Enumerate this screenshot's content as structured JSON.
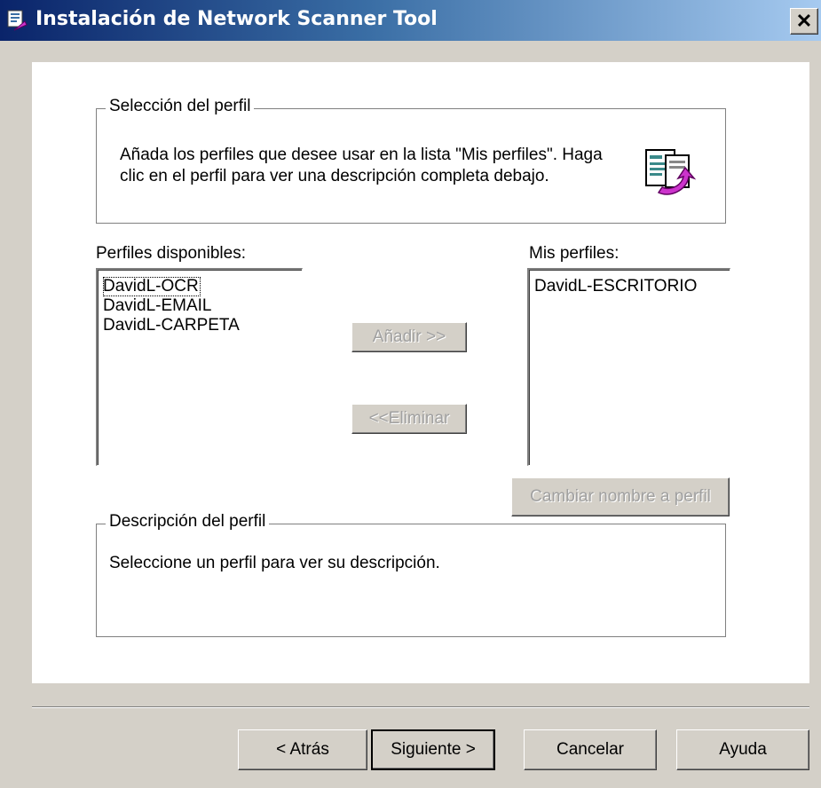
{
  "window": {
    "title": "Instalación de Network Scanner Tool",
    "close_glyph": "✕"
  },
  "selection_group": {
    "legend": "Selección del perfil",
    "instructions": "Añada los perfiles que desee usar en la lista \"Mis perfiles\". Haga clic en el perfil para ver una descripción completa debajo.",
    "icon": "profile-document-arrow-icon"
  },
  "available": {
    "label": "Perfiles disponibles:",
    "items": [
      "DavidL-OCR",
      "DavidL-EMAIL",
      "DavidL-CARPETA"
    ]
  },
  "mine": {
    "label": "Mis perfiles:",
    "items": [
      "DavidL-ESCRITORIO"
    ]
  },
  "buttons": {
    "add": "Añadir >>",
    "remove": "<<Eliminar",
    "rename": "Cambiar nombre a perfil",
    "back": "< Atrás",
    "next": "Siguiente >",
    "cancel": "Cancelar",
    "help": "Ayuda"
  },
  "description_group": {
    "legend": "Descripción del perfil",
    "text": "Seleccione un perfil para ver su descripción."
  },
  "colors": {
    "face": "#d4d0c8",
    "title_start": "#0a246a",
    "title_end": "#a6caf0",
    "accent": "#cc33cc"
  }
}
